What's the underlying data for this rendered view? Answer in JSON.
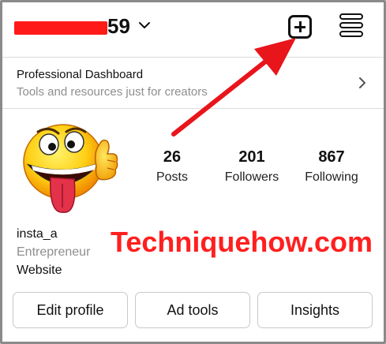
{
  "header": {
    "username_visible_suffix": "59",
    "redaction_color": "#ff1a1a",
    "dropdown_icon": "chevron-down-icon",
    "create_icon": "plus-square-icon",
    "menu_icon": "hamburger-menu-icon"
  },
  "dashboard": {
    "title": "Professional Dashboard",
    "subtitle": "Tools and resources just for creators",
    "chevron_icon": "chevron-right-icon"
  },
  "profile": {
    "avatar_icon": "tongue-out-thumbs-up-emoji",
    "stats": [
      {
        "value": "26",
        "label": "Posts"
      },
      {
        "value": "201",
        "label": "Followers"
      },
      {
        "value": "867",
        "label": "Following"
      }
    ],
    "bio": {
      "name": "insta_a",
      "category": "Entrepreneur",
      "website": "Website"
    }
  },
  "actions": {
    "edit_profile": "Edit profile",
    "ad_tools": "Ad tools",
    "insights": "Insights"
  },
  "overlay": {
    "watermark": "Techniquehow.com",
    "arrow_color": "#e8151b"
  }
}
